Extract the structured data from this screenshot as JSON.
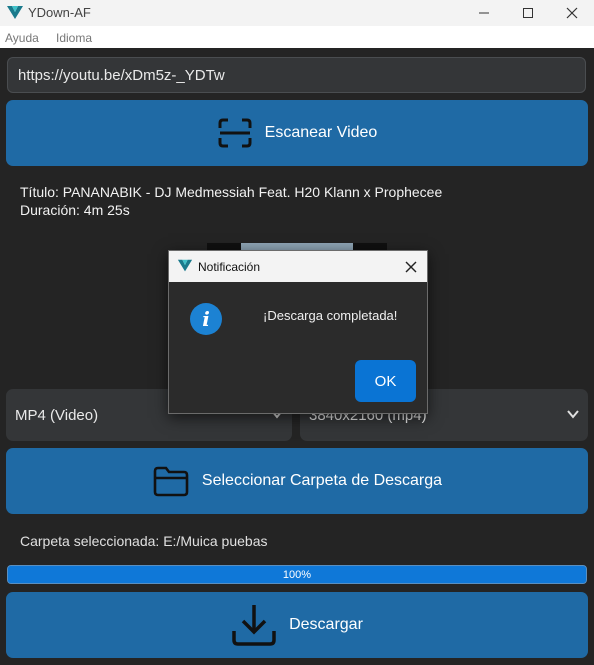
{
  "window": {
    "title": "YDown-AF",
    "minimize_icon": "minimize-icon",
    "maximize_icon": "maximize-icon",
    "close_icon": "close-icon"
  },
  "menu": {
    "items": [
      {
        "label": "Ayuda"
      },
      {
        "label": "Idioma"
      }
    ]
  },
  "url_input": {
    "value": "https://youtu.be/xDm5z-_YDTw"
  },
  "scan_button": {
    "label": "Escanear Video",
    "icon": "scan-icon"
  },
  "video_info": {
    "title_line": "Título: PANANABIK - DJ Medmessiah Feat. H20 Klann x Prophecee",
    "duration_line": "Duración: 4m 25s"
  },
  "format_select": {
    "value": "MP4 (Video)"
  },
  "quality_select": {
    "value": "3840x2160 (mp4)"
  },
  "folder_button": {
    "label": "Seleccionar Carpeta de Descarga",
    "icon": "folder-icon"
  },
  "folder_label": "Carpeta seleccionada: E:/Muica puebas",
  "progress": {
    "value": 1.0,
    "label": "100%"
  },
  "download_button": {
    "label": "Descargar",
    "icon": "download-icon"
  },
  "dialog": {
    "title": "Notificación",
    "message": "¡Descarga completada!",
    "ok_label": "OK",
    "info_icon_glyph": "i"
  },
  "colors": {
    "accent": "#1f6aa5",
    "background": "#242424",
    "input_bg": "#343638",
    "dialog_button": "#0a74d4"
  }
}
